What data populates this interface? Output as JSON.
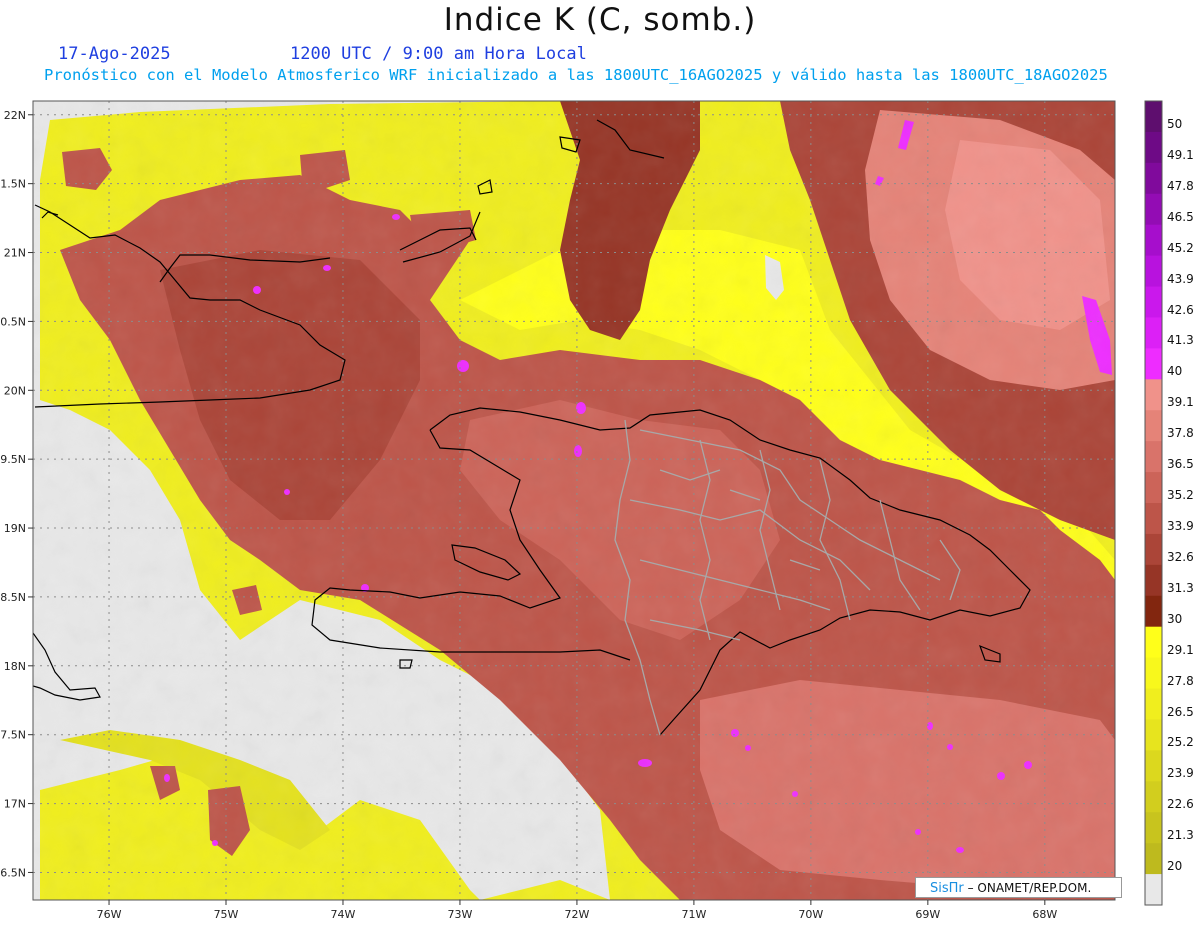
{
  "header": {
    "title": "Indice K (C, somb.)",
    "date": "17-Ago-2025",
    "valid_time": "1200 UTC / 9:00 am Hora Local",
    "subtitle": "Pronóstico con el Modelo Atmosferico WRF inicializado a las 1800UTC_16AGO2025 y válido hasta las  1800UTC_18AGO2025"
  },
  "axes": {
    "lat_labels": [
      "22N",
      "21.5N",
      "21N",
      "20.5N",
      "20N",
      "19.5N",
      "19N",
      "18.5N",
      "18N",
      "17.5N",
      "17N",
      "16.5N"
    ],
    "lat_values": [
      22,
      21.5,
      21,
      20.5,
      20,
      19.5,
      19,
      18.5,
      18,
      17.5,
      17,
      16.5
    ],
    "lon_labels": [
      "76W",
      "75W",
      "74W",
      "73W",
      "72W",
      "71W",
      "70W",
      "69W",
      "68W"
    ],
    "lon_values": [
      -76,
      -75,
      -74,
      -73,
      -72,
      -71,
      -70,
      -69,
      -68
    ],
    "lat_range": [
      16.3,
      22.1
    ],
    "lon_range": [
      -76.65,
      -67.4
    ],
    "grid": "dotted"
  },
  "colorbar": {
    "labels": [
      "50",
      "49.1",
      "47.8",
      "46.5",
      "45.2",
      "43.9",
      "42.6",
      "41.3",
      "40",
      "39.1",
      "37.8",
      "36.5",
      "35.2",
      "33.9",
      "32.6",
      "31.3",
      "30",
      "29.1",
      "27.8",
      "26.5",
      "25.2",
      "23.9",
      "22.6",
      "21.3",
      "20"
    ],
    "colors": {
      "purple": [
        "#5e0e6e",
        "#6e0a86",
        "#800a9c",
        "#930cb4",
        "#a60ecc",
        "#b812de",
        "#ca18ec",
        "#dc20f6",
        "#ee2cff"
      ],
      "red": [
        "#f0928a",
        "#e58378",
        "#d9736a",
        "#cc6459",
        "#bd5549",
        "#ab4538",
        "#963526",
        "#82260f"
      ],
      "yellow": [
        "#ffff1a",
        "#f8f81c",
        "#f0ee1e",
        "#e7e41e",
        "#dcd81e",
        "#d2ce1e",
        "#c8c41e",
        "#beba1e"
      ],
      "none": "#e8e8e8"
    }
  },
  "credit": {
    "brand": "SisПr",
    "text": " – ONAMET/REP.DOM."
  }
}
